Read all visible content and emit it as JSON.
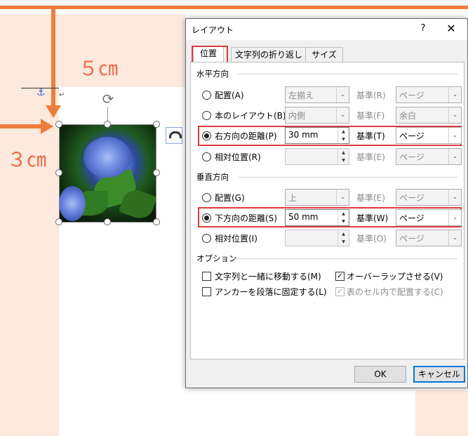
{
  "annotations": {
    "horizontal_distance": "５㎝",
    "vertical_distance": "３㎝",
    "accent_color": "#ef7d3a"
  },
  "dialog": {
    "title": "レイアウト",
    "help": "?",
    "close": "✕",
    "tabs": [
      "位置",
      "文字列の折り返し",
      "サイズ"
    ],
    "active_tab": "位置",
    "horizontal": {
      "heading": "水平方向",
      "rows": [
        {
          "label": "配置(A)",
          "selected": false,
          "value": "左揃え",
          "base_label": "基準(R)",
          "base_value": "ページ",
          "enabled": false
        },
        {
          "label": "本のレイアウト(B)",
          "selected": false,
          "value": "内側",
          "base_label": "基準(F)",
          "base_value": "余白",
          "enabled": false
        },
        {
          "label": "右方向の距離(P)",
          "selected": true,
          "value": "30 mm",
          "base_label": "基準(T)",
          "base_value": "ページ",
          "enabled": true
        },
        {
          "label": "相対位置(R)",
          "selected": false,
          "value": "",
          "base_label": "基準(E)",
          "base_value": "ページ",
          "enabled": false
        }
      ]
    },
    "vertical": {
      "heading": "垂直方向",
      "rows": [
        {
          "label": "配置(G)",
          "selected": false,
          "value": "上",
          "base_label": "基準(E)",
          "base_value": "ページ",
          "enabled": false
        },
        {
          "label": "下方向の距離(S)",
          "selected": true,
          "value": "50 mm",
          "base_label": "基準(W)",
          "base_value": "ページ",
          "enabled": true
        },
        {
          "label": "相対位置(I)",
          "selected": false,
          "value": "",
          "base_label": "基準(O)",
          "base_value": "ページ",
          "enabled": false
        }
      ]
    },
    "options": {
      "heading": "オプション",
      "move_with_text": {
        "label": "文字列と一緒に移動する(M)",
        "checked": false
      },
      "lock_anchor": {
        "label": "アンカーを段落に固定する(L)",
        "checked": false
      },
      "allow_overlap": {
        "label": "オーバーラップさせる(V)",
        "checked": true
      },
      "layout_in_cell": {
        "label": "表のセル内で配置する(C)",
        "checked": true,
        "enabled": false
      }
    },
    "ok": "OK",
    "cancel": "キャンセル"
  },
  "icons": {
    "anchor": "⚓",
    "rotate": "⟳",
    "pilcrow": "↵",
    "dropdown": "⌄"
  }
}
